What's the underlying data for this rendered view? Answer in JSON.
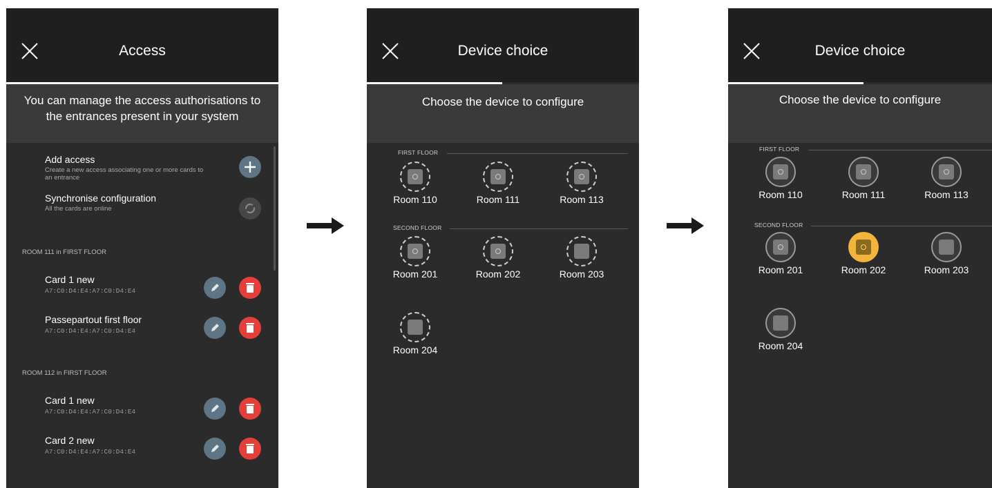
{
  "panel1": {
    "title": "Access",
    "intro": "You can manage the access authorisations to the entrances present in your system",
    "add_access": {
      "title": "Add access",
      "description": "Create a new access associating one or more cards to an entrance"
    },
    "sync": {
      "title": "Synchronise configuration",
      "description": "All the cards are online"
    },
    "sections": [
      {
        "label": "ROOM 111 in FIRST FLOOR",
        "cards": [
          {
            "name": "Card 1 new",
            "code": "A7:C0:D4:E4:A7:C0:D4:E4"
          },
          {
            "name": "Passepartout first floor",
            "code": "A7:C0:D4:E4:A7:C0:D4:E4"
          }
        ]
      },
      {
        "label": "ROOM 112 in FIRST FLOOR",
        "cards": [
          {
            "name": "Card 1 new",
            "code": "A7:C0:D4:E4:A7:C0:D4:E4"
          },
          {
            "name": "Card 2 new",
            "code": "A7:C0:D4:E4:A7:C0:D4:E4"
          }
        ]
      }
    ]
  },
  "panel2": {
    "title": "Device choice",
    "intro": "Choose the device to configure",
    "floors": [
      {
        "label": "FIRST FLOOR",
        "rooms": [
          "Room 110",
          "Room 111",
          "Room 113"
        ]
      },
      {
        "label": "SECOND FLOOR",
        "rooms": [
          "Room 201",
          "Room 202",
          "Room 203",
          "Room 204"
        ]
      }
    ]
  },
  "panel3": {
    "title": "Device choice",
    "intro": "Choose the device to configure",
    "selected_room": "Room 202",
    "floors": [
      {
        "label": "FIRST FLOOR",
        "rooms": [
          "Room 110",
          "Room 111",
          "Room 113"
        ]
      },
      {
        "label": "SECOND FLOOR",
        "rooms": [
          "Room 201",
          "Room 202",
          "Room 203",
          "Room 204"
        ]
      }
    ]
  },
  "colors": {
    "header_bg": "#1f1f1f",
    "screen_bg": "#2b2b2b",
    "edit_button": "#5e7585",
    "delete_button": "#e53f3a",
    "selected_device": "#f2b43a"
  },
  "icons": [
    "close-icon",
    "plus-icon",
    "sync-icon",
    "pencil-icon",
    "trash-icon",
    "chip-icon",
    "arrow-right-icon"
  ]
}
